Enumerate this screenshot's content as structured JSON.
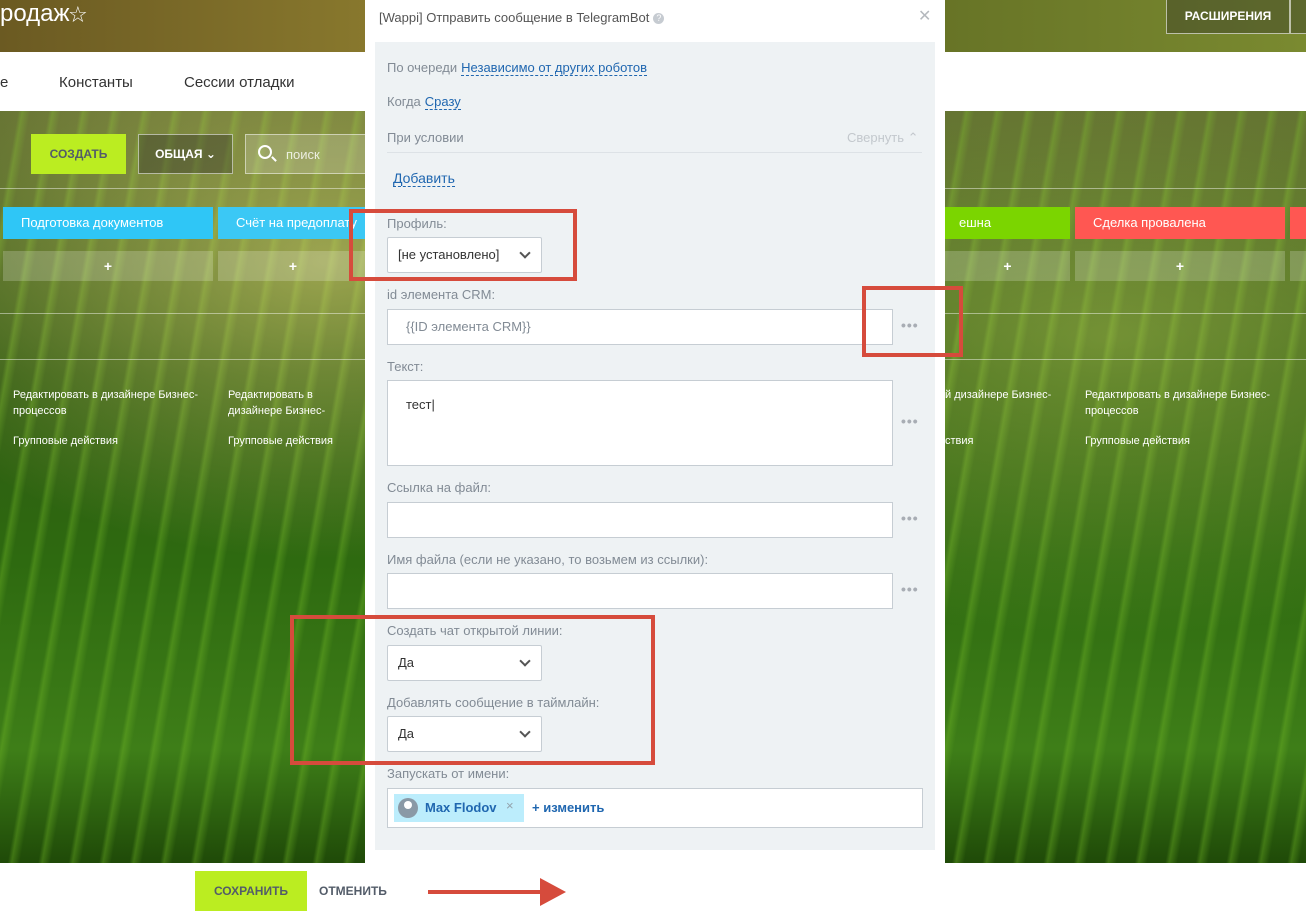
{
  "page": {
    "title": "родаж",
    "extensions_label": "РАСШИРЕНИЯ",
    "tabs": [
      "е",
      "Константы",
      "Сессии отладки"
    ]
  },
  "toolbar": {
    "create_label": "СОЗДАТЬ",
    "general_label": "ОБЩАЯ",
    "search_placeholder": "поиск"
  },
  "stages": [
    {
      "label": "Подготовка документов",
      "color": "#2fc6f6"
    },
    {
      "label": "Счёт на предоплату",
      "color": "#3bc8f5"
    },
    {
      "label": "ешна",
      "color": "#7bd500"
    },
    {
      "label": "Сделка провалена",
      "color": "#ff5752"
    }
  ],
  "column_links": {
    "designer": "Редактировать в дизайнере Бизнес-процессов",
    "group_actions": "Групповые действия",
    "plus": "+"
  },
  "modal": {
    "title": "[Wappi] Отправить сообщение в TelegramBot",
    "queue_label": "По очереди",
    "queue_value": "Независимо от других роботов",
    "when_label": "Когда",
    "when_value": "Сразу",
    "condition_label": "При условии",
    "collapse_label": "Свернуть",
    "add_label": "Добавить",
    "profile_label": "Профиль:",
    "profile_value": "[не установлено]",
    "crm_id_label": "id элемента CRM:",
    "crm_id_value": "{{ID элемента CRM}}",
    "text_label": "Текст:",
    "text_value": "тест",
    "file_link_label": "Ссылка на файл:",
    "file_name_label": "Имя файла (если не указано, то возьмем из ссылки):",
    "open_chat_label": "Создать чат открытой линии:",
    "open_chat_value": "Да",
    "timeline_label": "Добавлять сообщение в таймлайн:",
    "timeline_value": "Да",
    "run_as_label": "Запускать от имени:",
    "run_as_user": "Max Flodov",
    "change_label": "+ изменить",
    "more_dots": "•••"
  },
  "footer": {
    "save_label": "СОХРАНИТЬ",
    "cancel_label": "ОТМЕНИТЬ"
  },
  "colors": {
    "accent_green": "#bbed21",
    "link_blue": "#2067b0",
    "annotation_red": "#d64b3c"
  }
}
